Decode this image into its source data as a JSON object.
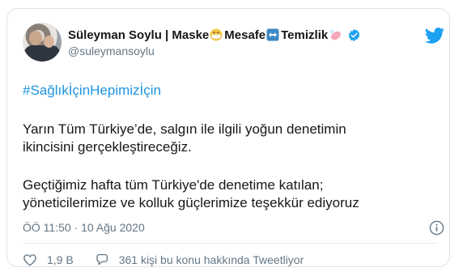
{
  "tweet": {
    "author_name": "Süleyman Soylu | Maske",
    "name_part_2": "Mesafe",
    "name_part_3": "Temizlik",
    "handle": "@suleymansoylu",
    "hashtag": "#SağlıkİçinHepimizİçin",
    "lines": [
      "Yarın Tüm Türkiye’de, salgın ile ilgili yoğun denetimin",
      "ikincisini gerçekleştireceğiz.",
      "Geçtiğimiz hafta tüm Türkiye'de denetime katılan;",
      "yöneticilerimize ve kolluk güçlerimize teşekkür ediyoruz"
    ],
    "timestamp": "ÖÖ 11:50 · 10 Ağu 2020",
    "like_count": "1,9 B",
    "conversation_text": "361 kişi bu konu hakkında Tweetliyor"
  },
  "colors": {
    "link": "#1b95e0",
    "muted": "#657786",
    "text": "#14171a",
    "verified": "#1da1f2",
    "brand": "#1da1f2"
  },
  "icons": {
    "name_emoji_1": "face-with-mask-emoji",
    "name_emoji_2": "left-right-arrow-emoji",
    "name_emoji_3": "soap-emoji",
    "verified": "verified-badge-icon",
    "brand": "twitter-bird-icon",
    "info": "info-icon",
    "like": "heart-icon",
    "reply": "speech-bubble-icon"
  }
}
